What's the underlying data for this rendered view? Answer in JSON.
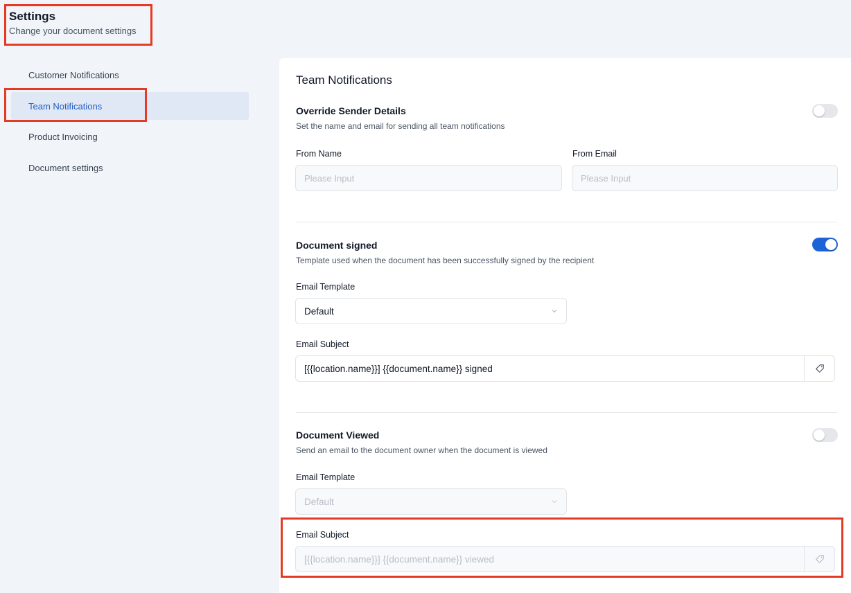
{
  "header": {
    "title": "Settings",
    "subtitle": "Change your document settings"
  },
  "sidebar": {
    "items": [
      {
        "label": "Customer Notifications",
        "active": false
      },
      {
        "label": "Team Notifications",
        "active": true
      },
      {
        "label": "Product Invoicing",
        "active": false
      },
      {
        "label": "Document settings",
        "active": false
      }
    ]
  },
  "main": {
    "title": "Team Notifications",
    "override": {
      "title": "Override Sender Details",
      "description": "Set the name and email for sending all team notifications",
      "enabled": false,
      "from_name_label": "From Name",
      "from_name_placeholder": "Please Input",
      "from_email_label": "From Email",
      "from_email_placeholder": "Please Input"
    },
    "document_signed": {
      "title": "Document signed",
      "description": "Template used when the document has been successfully signed by the recipient",
      "enabled": true,
      "template_label": "Email Template",
      "template_value": "Default",
      "subject_label": "Email Subject",
      "subject_value": "[{{location.name}}] {{document.name}} signed"
    },
    "document_viewed": {
      "title": "Document Viewed",
      "description": "Send an email to the document owner when the document is viewed",
      "enabled": false,
      "template_label": "Email Template",
      "template_value": "Default",
      "subject_label": "Email Subject",
      "subject_value": "[{{location.name}}] {{document.name}} viewed"
    }
  },
  "colors": {
    "accent": "#1d63d8",
    "highlight": "#e53a24",
    "active_nav_bg": "#e0e7f5"
  }
}
